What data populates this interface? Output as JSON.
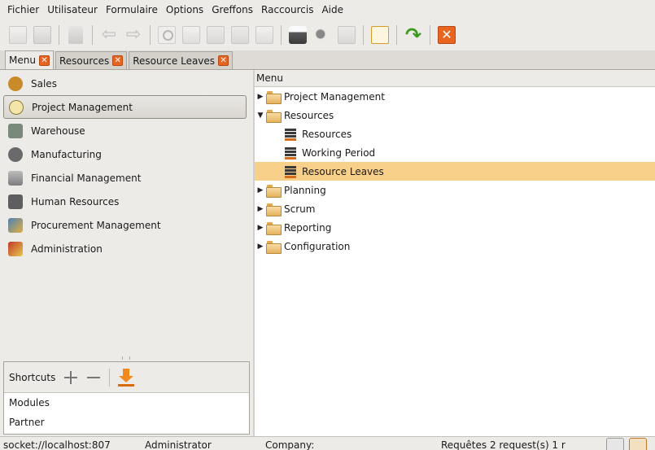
{
  "menubar": [
    {
      "label": "Fichier"
    },
    {
      "label": "Utilisateur"
    },
    {
      "label": "Formulaire"
    },
    {
      "label": "Options"
    },
    {
      "label": "Greffons"
    },
    {
      "label": "Raccourcis"
    },
    {
      "label": "Aide"
    }
  ],
  "tabs": [
    {
      "label": "Menu"
    },
    {
      "label": "Resources"
    },
    {
      "label": "Resource Leaves"
    }
  ],
  "modules": [
    {
      "label": "Sales",
      "icon": "people-icon",
      "color": "#c98a2a"
    },
    {
      "label": "Project Management",
      "icon": "clock-icon",
      "color": "#e7d07a"
    },
    {
      "label": "Warehouse",
      "icon": "warehouse-icon",
      "color": "#7a8a7a"
    },
    {
      "label": "Manufacturing",
      "icon": "gears-icon",
      "color": "#6a6a6a"
    },
    {
      "label": "Financial Management",
      "icon": "finance-icon",
      "color": "#8f8f8f"
    },
    {
      "label": "Human Resources",
      "icon": "calculator-icon",
      "color": "#5e5e5e"
    },
    {
      "label": "Procurement Management",
      "icon": "procurement-icon",
      "color": "#4f7fb5"
    },
    {
      "label": "Administration",
      "icon": "scissors-icon",
      "color": "#c0392b"
    }
  ],
  "shortcuts": {
    "title": "Shortcuts",
    "items": [
      "Modules",
      "Partner"
    ]
  },
  "tree": {
    "header": "Menu",
    "rows": [
      {
        "label": "Project Management",
        "level": 0,
        "expander": "▶",
        "type": "folder"
      },
      {
        "label": "Resources",
        "level": 0,
        "expander": "▼",
        "type": "folder"
      },
      {
        "label": "Resources",
        "level": 1,
        "expander": "",
        "type": "leaf"
      },
      {
        "label": "Working Period",
        "level": 1,
        "expander": "",
        "type": "leaf"
      },
      {
        "label": "Resource Leaves",
        "level": 1,
        "expander": "",
        "type": "leaf",
        "selected": true
      },
      {
        "label": "Planning",
        "level": 0,
        "expander": "▶",
        "type": "folder"
      },
      {
        "label": "Scrum",
        "level": 0,
        "expander": "▶",
        "type": "folder"
      },
      {
        "label": "Reporting",
        "level": 0,
        "expander": "▶",
        "type": "folder"
      },
      {
        "label": "Configuration",
        "level": 0,
        "expander": "▶",
        "type": "folder"
      }
    ]
  },
  "status": {
    "connection": "socket://localhost:807",
    "user": "Administrator",
    "company": "Company:",
    "requests": "Requêtes 2 request(s) 1 r"
  },
  "colors": {
    "selection": "#f9d08a",
    "close_accent": "#e8641f"
  }
}
